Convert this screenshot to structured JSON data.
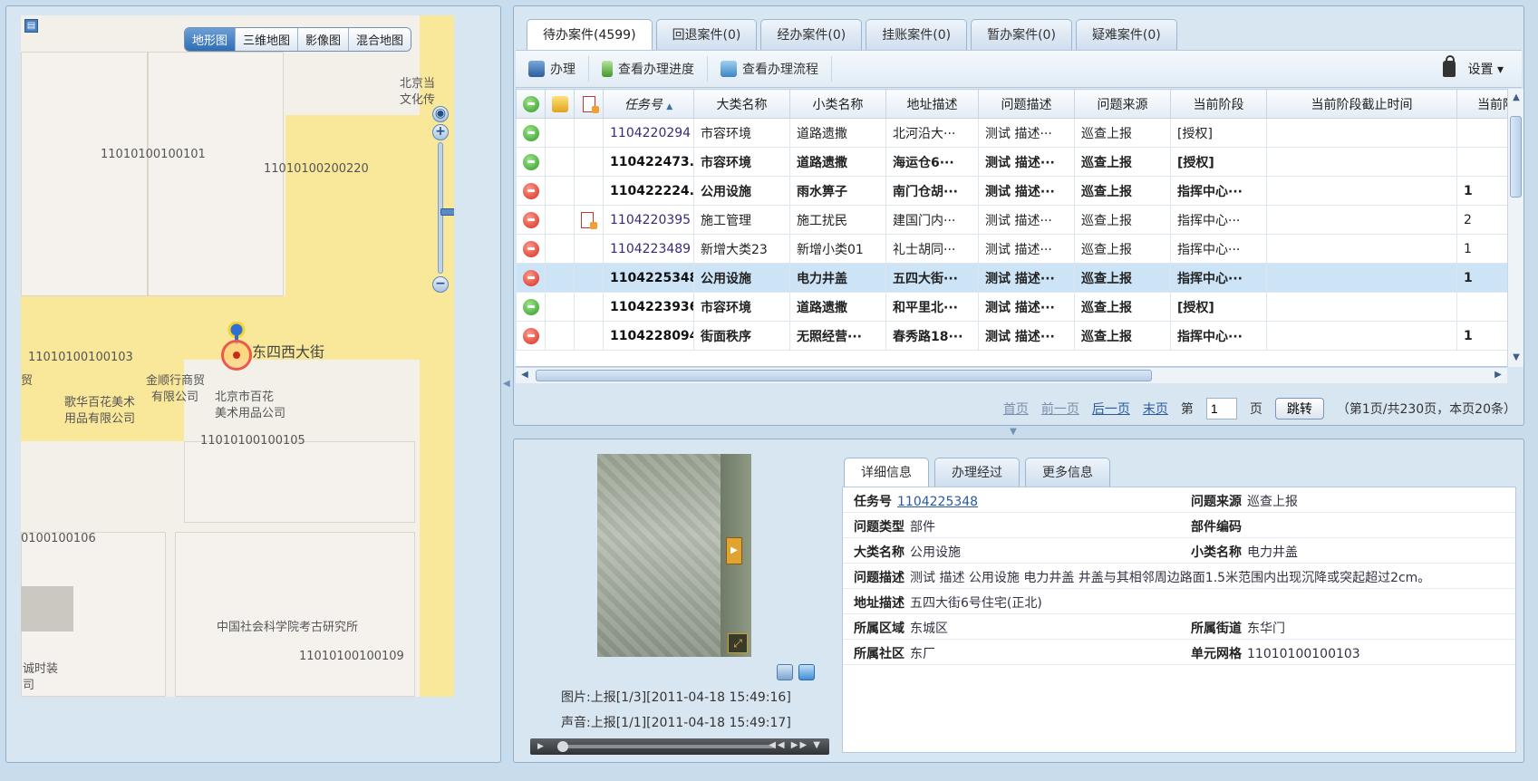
{
  "map": {
    "types": [
      "地形图",
      "三维地图",
      "影像图",
      "混合地图"
    ],
    "active_type": "地形图",
    "labels": {
      "street": "东四西大街",
      "grid1": "11010100100101",
      "grid2": "11010100200220",
      "grid3": "11010100100103",
      "grid4": "11010100100105",
      "grid5": "0100100106",
      "grid6": "11010100100109",
      "poi1": "金顺行商贸",
      "poi1b": "有限公司",
      "poi2": "北京市百花",
      "poi2b": "美术用品公司",
      "poi3": "歌华百花美术",
      "poi3b": "用品有限公司",
      "poi4": "中国社会科学院考古研究所",
      "poi5": "北京当",
      "poi5b": "文化传",
      "poi6": "诚时装",
      "poi6b": "司",
      "poi7": "贸"
    }
  },
  "tabs": [
    "待办案件(4599)",
    "回退案件(0)",
    "经办案件(0)",
    "挂账案件(0)",
    "暂办案件(0)",
    "疑难案件(0)"
  ],
  "active_tab": 0,
  "toolbar": {
    "handle": "办理",
    "progress": "查看办理进度",
    "flow": "查看办理流程",
    "settings": "设置"
  },
  "grid": {
    "headers": [
      "任务号",
      "大类名称",
      "小类名称",
      "地址描述",
      "问题描述",
      "问题来源",
      "当前阶段",
      "当前阶段截止时间",
      "当前阶"
    ],
    "rows": [
      {
        "status": "green",
        "doc": false,
        "bold": false,
        "selected": false,
        "cells": [
          "1104220294",
          "市容环境",
          "道路遗撒",
          "北河沿大···",
          "测试 描述···",
          "巡查上报",
          "[授权]",
          "",
          ""
        ]
      },
      {
        "status": "green",
        "doc": false,
        "bold": true,
        "selected": false,
        "cells": [
          "110422473...",
          "市容环境",
          "道路遗撒",
          "海运仓6···",
          "测试 描述···",
          "巡查上报",
          "[授权]",
          "",
          ""
        ]
      },
      {
        "status": "red",
        "doc": false,
        "bold": true,
        "selected": false,
        "cells": [
          "110422224...",
          "公用设施",
          "雨水箅子",
          "南门仓胡···",
          "测试 描述···",
          "巡查上报",
          "指挥中心···",
          "",
          "1"
        ]
      },
      {
        "status": "red",
        "doc": true,
        "bold": false,
        "selected": false,
        "cells": [
          "1104220395",
          "施工管理",
          "施工扰民",
          "建国门内···",
          "测试 描述···",
          "巡查上报",
          "指挥中心···",
          "",
          "2"
        ]
      },
      {
        "status": "red",
        "doc": false,
        "bold": false,
        "selected": false,
        "cells": [
          "1104223489",
          "新增大类23",
          "新增小类01",
          "礼士胡同···",
          "测试 描述···",
          "巡查上报",
          "指挥中心···",
          "",
          "1"
        ]
      },
      {
        "status": "red",
        "doc": false,
        "bold": true,
        "selected": true,
        "cells": [
          "1104225348",
          "公用设施",
          "电力井盖",
          "五四大街···",
          "测试 描述···",
          "巡查上报",
          "指挥中心···",
          "",
          "1"
        ]
      },
      {
        "status": "green",
        "doc": false,
        "bold": true,
        "selected": false,
        "cells": [
          "1104223936",
          "市容环境",
          "道路遗撒",
          "和平里北···",
          "测试 描述···",
          "巡查上报",
          "[授权]",
          "",
          ""
        ]
      },
      {
        "status": "red",
        "doc": false,
        "bold": true,
        "selected": false,
        "cells": [
          "1104228094",
          "街面秩序",
          "无照经营···",
          "春秀路18···",
          "测试 描述···",
          "巡查上报",
          "指挥中心···",
          "",
          "1"
        ]
      }
    ]
  },
  "pager": {
    "first": "首页",
    "prev": "前一页",
    "next": "后一页",
    "last": "末页",
    "page_prefix": "第",
    "page_value": "1",
    "page_suffix": "页",
    "jump": "跳转",
    "summary": "（第1页/共230页，本页20条）"
  },
  "media": {
    "photo_caption": "图片:上报[1/3][2011-04-18 15:49:16]",
    "audio_caption": "声音:上报[1/1][2011-04-18 15:49:17]"
  },
  "detail_tabs": [
    "详细信息",
    "办理经过",
    "更多信息"
  ],
  "detail": {
    "task_no_label": "任务号",
    "task_no": "1104225348",
    "source_label": "问题来源",
    "source": "巡查上报",
    "type_label": "问题类型",
    "type": "部件",
    "part_code_label": "部件编码",
    "part_code": "",
    "category_label": "大类名称",
    "category": "公用设施",
    "subcategory_label": "小类名称",
    "subcategory": "电力井盖",
    "desc_label": "问题描述",
    "desc": "测试 描述 公用设施 电力井盖 井盖与其相邻周边路面1.5米范围内出现沉降或突起超过2cm。",
    "address_label": "地址描述",
    "address": "五四大街6号住宅(正北)",
    "district_label": "所属区域",
    "district": "东城区",
    "street_label": "所属街道",
    "street": "东华门",
    "community_label": "所属社区",
    "community": "东厂",
    "grid_label": "单元网格",
    "grid": "11010100100103"
  }
}
